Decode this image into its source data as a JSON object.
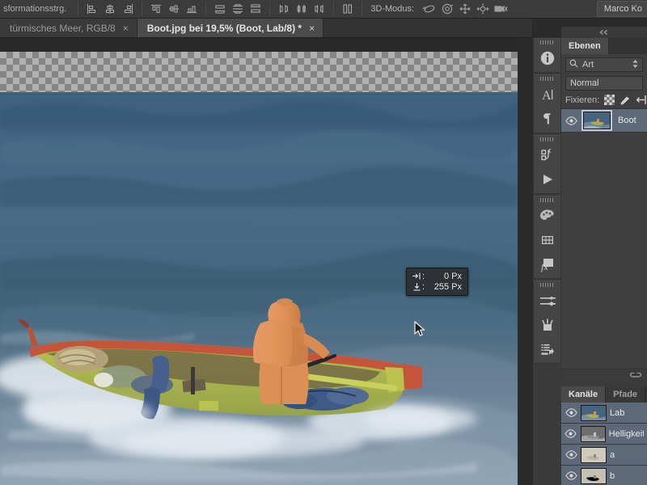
{
  "options_bar": {
    "tool_label": "sformationsstrg.",
    "align_icons": [
      "align-left-edges-icon",
      "align-horizontal-centers-icon",
      "align-right-edges-icon",
      "align-top-edges-icon",
      "align-vertical-centers-icon",
      "align-bottom-edges-icon",
      "distribute-top-edges-icon",
      "distribute-vertical-centers-icon",
      "distribute-bottom-edges-icon",
      "distribute-left-edges-icon",
      "distribute-horizontal-centers-icon",
      "distribute-right-edges-icon"
    ],
    "auto_select_icon": "distribute-spacing-icon",
    "mode3d_label": "3D-Modus:",
    "mode3d_icons": [
      "rotate-3d-icon",
      "roll-3d-icon",
      "pan-3d-icon",
      "slide-3d-icon",
      "scale-3d-camera-icon"
    ],
    "user_chip": "Marco Ko"
  },
  "tabs": [
    {
      "title": "türmisches Meer, RGB/8",
      "close": "×",
      "active": false
    },
    {
      "title": "Boot.jpg bei 19,5% (Boot, Lab/8) *",
      "close": "×",
      "active": true
    }
  ],
  "canvas": {
    "zoom_level": "19,5%",
    "info_hud": {
      "offset_x_icon": "horizontal-offset-icon",
      "offset_x_label": ":",
      "offset_x_value": "0 Px",
      "offset_y_icon": "vertical-offset-icon",
      "offset_y_label": ":",
      "offset_y_value": "255 Px"
    },
    "cursor_icon": "mouse-pointer-icon"
  },
  "icon_dock": {
    "collapse_icon": "collapse-panels-icon",
    "groups": [
      {
        "items": [
          {
            "icon": "info-icon"
          }
        ]
      },
      {
        "items": [
          {
            "icon": "character-panel-icon"
          },
          {
            "icon": "paragraph-panel-icon"
          }
        ]
      },
      {
        "items": [
          {
            "icon": "actions-panel-icon"
          },
          {
            "icon": "play-action-icon"
          }
        ]
      },
      {
        "items": [
          {
            "icon": "color-swatches-icon"
          },
          {
            "icon": "styles-grid-icon"
          },
          {
            "icon": "layer-effects-fx-icon"
          }
        ]
      },
      {
        "items": [
          {
            "icon": "brush-presets-icon"
          },
          {
            "icon": "tool-presets-icon"
          },
          {
            "icon": "layer-comps-icon"
          }
        ]
      }
    ]
  },
  "layers_panel": {
    "tab_label": "Ebenen",
    "filter": {
      "search_icon": "search-icon",
      "kind_label": "Art",
      "stepper_icon": "updown-arrows-icon"
    },
    "blend_mode": "Normal",
    "lock": {
      "label": "Fixieren:",
      "icons": [
        "lock-transparent-pixels-icon",
        "lock-image-pixels-icon",
        "lock-position-icon"
      ]
    },
    "layers": [
      {
        "name": "Boot",
        "visible_icon": "eye-icon",
        "selected": true
      }
    ],
    "footer_icon": "link-layers-icon"
  },
  "channels_panel": {
    "tabs": [
      {
        "label": "Kanäle",
        "active": true
      },
      {
        "label": "Pfade",
        "active": false
      }
    ],
    "channels": [
      {
        "name": "Lab",
        "visible_icon": "eye-icon",
        "kind": "composite"
      },
      {
        "name": "Helligkeit",
        "visible_icon": "eye-icon",
        "kind": "lightness"
      },
      {
        "name": "a",
        "visible_icon": "eye-icon",
        "kind": "a-channel"
      },
      {
        "name": "b",
        "visible_icon": "eye-icon",
        "kind": "b-channel"
      }
    ]
  },
  "colors": {
    "app_bg": "#3b3b3b",
    "panel_bg": "#3f3f3f",
    "selection_blue": "#5d6878",
    "canvas_bg": "#2b2b2b",
    "text": "#bdbdbd"
  }
}
